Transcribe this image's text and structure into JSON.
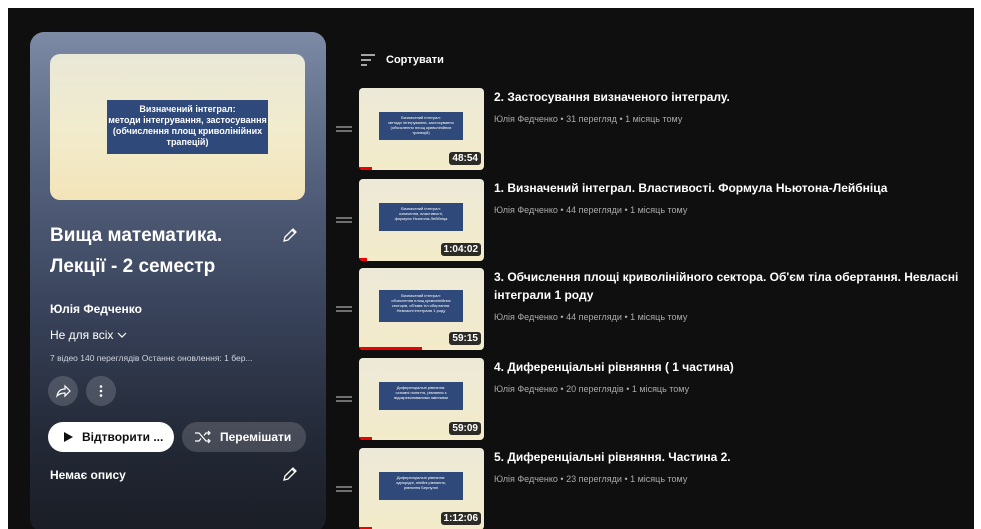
{
  "playlist": {
    "cover_text": "Визначений інтеграл:\nметоди інтегрування, застосування\n(обчислення площ криволінійних\nтрапецій)",
    "title_line1": "Вища математика.",
    "title_line2": "Лекції - 2 семестр",
    "owner": "Юлія Федченко",
    "privacy": "Не для всіх",
    "stats": "7 відео  140 переглядів  Останнє оновлення: 1 бер...",
    "play_label": "Відтворити ...",
    "shuffle_label": "Перемішати",
    "description": "Немає опису"
  },
  "sort_label": "Сортувати",
  "videos": [
    {
      "title": "2. Застосування визначеного інтегралу.",
      "meta": "Юлія Федченко • 31 перегляд • 1 місяць тому",
      "duration": "48:54",
      "thumb_text": "Визначений інтеграл:\nметоди інтегрування, застосування\n(обчислення площ криволінійних\nтрапецій)",
      "watched": 0.1
    },
    {
      "title": "1. Визначений інтеграл. Властивості. Формула Ньютона-Лейбніца",
      "meta": "Юлія Федченко • 44 перегляди • 1 місяць тому",
      "duration": "1:04:02",
      "thumb_text": "Визначений інтеграл:\nозначення, властивості,\nформула Ньютона-Лейбніца",
      "watched": 0.06
    },
    {
      "title": "3. Обчислення площі криволінійного сектора. Об'єм тіла обертання. Невласні інтеграли 1 роду",
      "meta": "Юлія Федченко • 44 перегляди • 1 місяць тому",
      "duration": "59:15",
      "thumb_text": "Визначений інтеграл:\nобчислення площ криволінійних\nсекторів, об'ємів тіл обертання.\nНевласні інтеграли 1 роду",
      "watched": 0.5
    },
    {
      "title": "4. Диференціальні рівняння ( 1 частина)",
      "meta": "Юлія Федченко • 20 переглядів • 1 місяць тому",
      "duration": "59:09",
      "thumb_text": "Диференціальні рівняння:\nосновні поняття, рівняння з\nвідокремлюваними змінними",
      "watched": 0.1
    },
    {
      "title": "5. Диференціальні рівняння. Частина 2.",
      "meta": "Юлія Федченко • 23 перегляди • 1 місяць тому",
      "duration": "1:12:06",
      "thumb_text": "Диференціальні рівняння:\nоднорідні, лінійні рівняння,\nрівняння Бернуллі",
      "watched": 0.1
    }
  ],
  "colors": {
    "background": "#0f0f0f",
    "progress": "#ee0000",
    "cover_box": "#2f4a7a"
  }
}
